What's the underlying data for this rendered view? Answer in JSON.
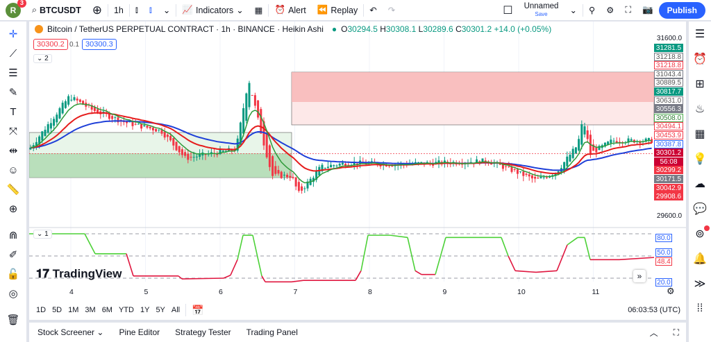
{
  "topbar": {
    "avatar": "R",
    "notifications": "3",
    "symbol": "BTCUSDT",
    "interval": "1h",
    "indicators": "Indicators",
    "alert": "Alert",
    "replay": "Replay",
    "layout_name": "Unnamed",
    "layout_save": "Save",
    "publish": "Publish"
  },
  "legend": {
    "title": "Bitcoin / TetherUS PERPETUAL CONTRACT · 1h · BINANCE · Heikin Ashi",
    "o_label": "O",
    "o": "30294.5",
    "h_label": "H",
    "h": "30308.1",
    "l_label": "L",
    "l": "30289.6",
    "c_label": "C",
    "c": "30301.2",
    "change": "+14.0 (+0.05%)",
    "sell": "30300.2",
    "spread": "0.1",
    "buy": "30300.3",
    "collapse_count": "2",
    "indicator_count": "1"
  },
  "price_scale": {
    "top": "31600.0",
    "bottom": "29600.0",
    "labels": [
      {
        "v": "31281.5",
        "p": 31281.5,
        "bg": "#089981",
        "fg": "#fff",
        "bd": "#089981"
      },
      {
        "v": "31218.8",
        "p": 31218.8,
        "bg": "#fff",
        "fg": "#555",
        "bd": "#787b86"
      },
      {
        "v": "31218.8",
        "p": 31218.8,
        "bg": "#fff",
        "fg": "#f23645",
        "bd": "#f23645"
      },
      {
        "v": "31043.4",
        "p": 31043.4,
        "bg": "#fff",
        "fg": "#555",
        "bd": "#787b86"
      },
      {
        "v": "30889.5",
        "p": 30889.5,
        "bg": "#fff",
        "fg": "#555",
        "bd": "#787b86"
      },
      {
        "v": "30817.7",
        "p": 30817.7,
        "bg": "#089981",
        "fg": "#fff",
        "bd": "#089981"
      },
      {
        "v": "30631.0",
        "p": 30631.0,
        "bg": "#fff",
        "fg": "#555",
        "bd": "#787b86"
      },
      {
        "v": "30556.3",
        "p": 30556.3,
        "bg": "#787b86",
        "fg": "#fff",
        "bd": "#787b86"
      },
      {
        "v": "30508.0",
        "p": 30508.0,
        "bg": "#fff",
        "fg": "#2e7d32",
        "bd": "#4caf50"
      },
      {
        "v": "30494.1",
        "p": 30494.1,
        "bg": "#fff",
        "fg": "#f23645",
        "bd": "#f23645"
      },
      {
        "v": "30453.9",
        "p": 30453.9,
        "bg": "#fff",
        "fg": "#f23645",
        "bd": "#f23645"
      },
      {
        "v": "30387.8",
        "p": 30387.8,
        "bg": "#fff",
        "fg": "#2962ff",
        "bd": "#2962ff"
      },
      {
        "v": "30301.2",
        "p": 30301.2,
        "bg": "#cc0033",
        "fg": "#fff",
        "bd": "#cc0033"
      },
      {
        "v": "56:08",
        "p": 30240,
        "bg": "#cc0033",
        "fg": "#fff",
        "bd": "#cc0033"
      },
      {
        "v": "30299.2",
        "p": 30180,
        "bg": "#f23645",
        "fg": "#fff",
        "bd": "#f23645"
      },
      {
        "v": "30171.5",
        "p": 30080,
        "bg": "#787b86",
        "fg": "#fff",
        "bd": "#787b86"
      },
      {
        "v": "30042.9",
        "p": 29985,
        "bg": "#f23645",
        "fg": "#fff",
        "bd": "#f23645"
      },
      {
        "v": "29908.6",
        "p": 29890,
        "bg": "#f23645",
        "fg": "#fff",
        "bd": "#f23645"
      }
    ]
  },
  "osc_scale": [
    {
      "v": "80.0",
      "fg": "#2962ff"
    },
    {
      "v": "50.0",
      "fg": "#2962ff"
    },
    {
      "v": "48.4",
      "fg": "#f23645"
    },
    {
      "v": "20.0",
      "fg": "#2962ff"
    }
  ],
  "time_axis": [
    "4",
    "5",
    "6",
    "7",
    "8",
    "9",
    "10",
    "11"
  ],
  "ranges": [
    "1D",
    "5D",
    "1M",
    "3M",
    "6M",
    "YTD",
    "1Y",
    "5Y",
    "All"
  ],
  "clock": "06:03:53 (UTC)",
  "panel_tabs": [
    "Stock Screener",
    "Pine Editor",
    "Strategy Tester",
    "Trading Panel"
  ],
  "logo": "TradingView",
  "colors": {
    "up": "#089981",
    "down": "#f23645",
    "accent": "#2962ff"
  }
}
